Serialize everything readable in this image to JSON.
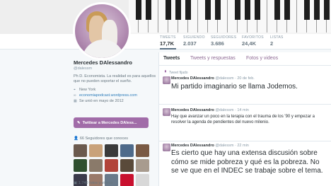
{
  "profile": {
    "name": "Mercedes DAlessandro",
    "handle": "@dalessm",
    "bio": "Ph D. Economista. La realidad es para aquellos que no pueden soportar el sueño.",
    "location": "New York",
    "website": "economiapodcast.wordpress.com",
    "joined": "Se unió en mayo de 2012",
    "tweet_to_label": "Twittear a Mercedes DAless...",
    "followers_you_know": "66 Seguidores que conoces",
    "photos_videos": "1.740 fotos y videos"
  },
  "stats": [
    {
      "label": "TWEETS",
      "value": "17,7K"
    },
    {
      "label": "SIGUIENDO",
      "value": "2.037"
    },
    {
      "label": "SEGUIDORES",
      "value": "3.686"
    },
    {
      "label": "FAVORITOS",
      "value": "24,4K"
    },
    {
      "label": "LISTAS",
      "value": "2"
    }
  ],
  "tabs": [
    "Tweets",
    "Tweets y respuestas",
    "Fotos y videos"
  ],
  "pinned_label": "Tweet fijado",
  "tweets": [
    {
      "name": "Mercedes DAlessandro",
      "handle": "@dalessm",
      "time": "· 20 de feb.",
      "text": "Mi partido imaginario se llama Jodemos."
    },
    {
      "name": "Mercedes DAlessandro",
      "handle": "@dalessm",
      "time": "· 14 min",
      "text": "Hay que avanzar un poco en la terapia con el trauma de los '90 y empezar a resolver la agenda de pendientes del nuevo milenio."
    },
    {
      "name": "Mercedes DAlessandro",
      "handle": "@dalessm",
      "time": "· 22 min",
      "text": "Es cierto que hay una extensa discusión sobre cómo se mide pobreza y qué es la pobreza. No se ve que en el INDEC se trabaje sobre el tema."
    }
  ],
  "icons": {
    "pin": "pin-icon",
    "location": "location-pin-icon",
    "link": "link-icon",
    "calendar": "calendar-icon",
    "followers": "people-icon",
    "photo": "photo-icon",
    "tweet_to": "compose-icon"
  },
  "colors": {
    "accent": "#a16ca8",
    "link": "#2b7bb9",
    "muted": "#8899a6"
  },
  "follower_thumbs": [
    "#6b5a4e",
    "#c9a27a",
    "#3b3b3b",
    "#4e6a8a",
    "#7a5a44",
    "#2f4f2f",
    "#8a7a6a",
    "#b2443a",
    "#5a4a3a",
    "#a89b8e",
    "#3a3a4a",
    "#9a7a6a",
    "#6a7a8a",
    "#c8102e",
    "#d8d8d8"
  ]
}
